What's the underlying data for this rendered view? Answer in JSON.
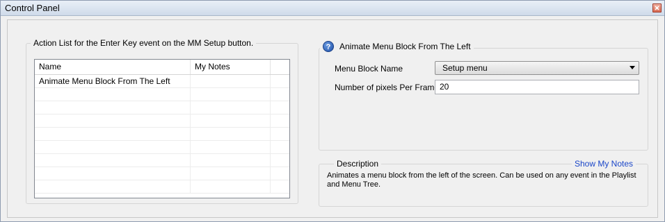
{
  "window": {
    "title": "Control Panel"
  },
  "action_list": {
    "legend": "Action List for the Enter Key event on the MM Setup button.",
    "columns": [
      "Name",
      "My Notes"
    ],
    "rows": [
      {
        "name": "Animate Menu Block From The Left",
        "notes": ""
      }
    ]
  },
  "action_detail": {
    "title": "Animate Menu Block From The Left",
    "fields": {
      "menu_block_name_label": "Menu Block Name",
      "menu_block_name_value": "Setup menu",
      "pixels_label": "Number of pixels Per Frame",
      "pixels_value": "20"
    }
  },
  "description": {
    "legend": "Description",
    "show_notes_link": "Show My Notes",
    "text": "Animates a menu block from the left of the screen.  Can be used on any event in the Playlist and Menu Tree."
  },
  "icons": {
    "help": "help-icon",
    "close": "close-icon",
    "dropdown": "chevron-down-icon"
  }
}
